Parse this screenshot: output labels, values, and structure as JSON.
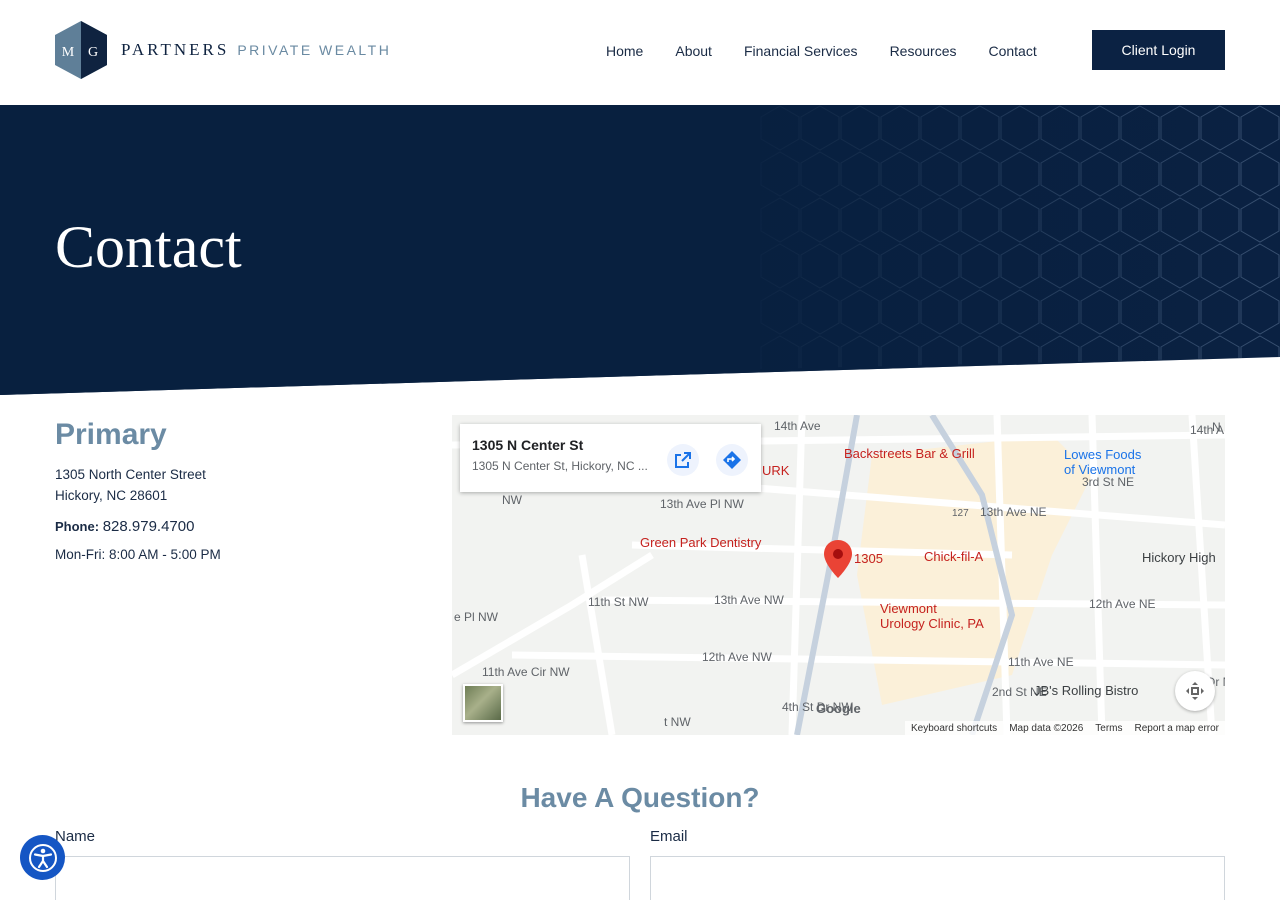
{
  "header": {
    "logo_letters": "M G",
    "logo_partners": "PARTNERS",
    "logo_private_wealth": "PRIVATE WEALTH",
    "nav": [
      "Home",
      "About",
      "Financial Services",
      "Resources",
      "Contact"
    ],
    "login_label": "Client Login"
  },
  "hero": {
    "title": "Contact"
  },
  "primary": {
    "title": "Primary",
    "street": "1305 North Center Street",
    "city": "Hickory, NC 28601",
    "phone_label": "Phone:",
    "phone": "828.979.4700",
    "hours": "Mon-Fri: 8:00 AM - 5:00 PM"
  },
  "map": {
    "card_title": "1305 N Center St",
    "card_address": "1305 N Center St, Hickory, NC ...",
    "marker_label": "1305",
    "pois": {
      "backstreets": "Backstreets Bar & Grill",
      "lowes1": "Lowes Foods",
      "lowes2": "of Viewmont",
      "green_park": "Green Park Dentistry",
      "chickfila": "Chick-fil-A",
      "hickory_high": "Hickory High",
      "viewmont1": "Viewmont",
      "viewmont2": "Urology Clinic, PA",
      "jbs": "JB's Rolling Bistro",
      "urk": "URK"
    },
    "streets": {
      "s14th": "14th Ave",
      "s14th_r": "14th A",
      "s13th_pl": "13th Ave Pl NW",
      "s13th_ne": "13th Ave NE",
      "s13th_nw": "13th Ave NW",
      "s12th_ne": "12th Ave NE",
      "s12th_nw": "12th Ave NW",
      "s11th_ne": "11th Ave NE",
      "s11th_cir": "11th Ave Cir NW",
      "s11th_cir2": "11th Ave Cir NW",
      "s11th_st": "11th St NW",
      "s2nd_st": "2nd St NE",
      "s3rd_st": "3rd St NE",
      "s4th_st": "4th St Dr NW",
      "hwy127": "127",
      "ave_pl": "e Pl NW",
      "nw": "NW",
      "st_nw": "t NW",
      "st_dr": "t Dr N",
      "n_e": "N E"
    },
    "google": "Google",
    "footer": [
      "Keyboard shortcuts",
      "Map data ©2026",
      "Terms",
      "Report a map error"
    ]
  },
  "question": {
    "title": "Have A Question?",
    "name_label": "Name",
    "email_label": "Email"
  },
  "colors": {
    "navy": "#0b2243",
    "slate": "#6b8ba4",
    "accessibility": "#1556c4"
  }
}
